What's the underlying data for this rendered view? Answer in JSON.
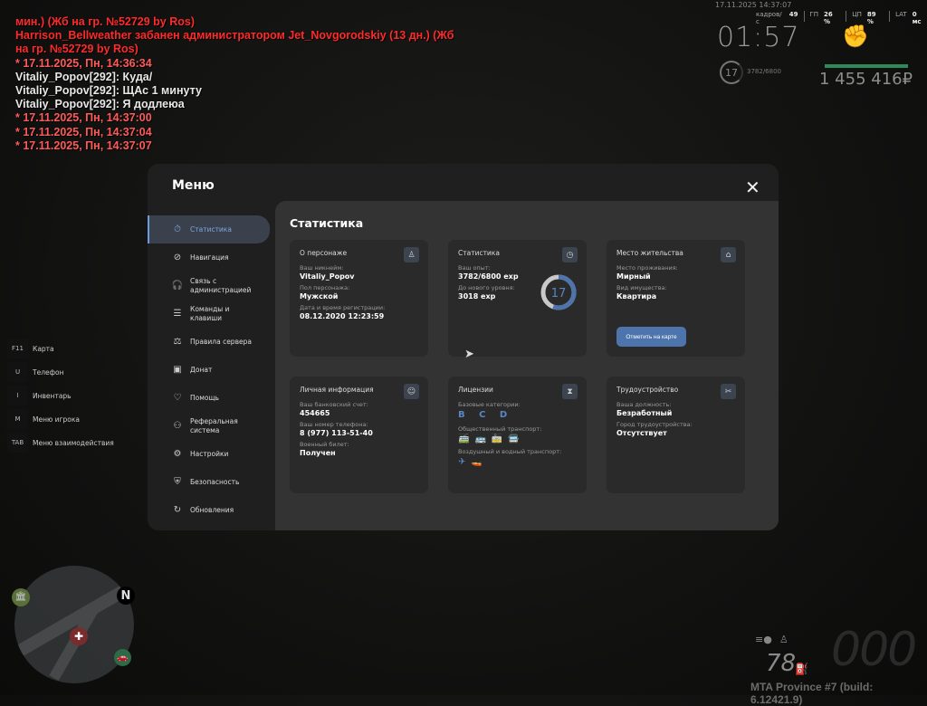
{
  "chat": [
    {
      "text": "мин.) (Жб на гр. №52729 by Ros)",
      "color": "red"
    },
    {
      "text": "Harrison_Bellweather забанен администратором Jet_Novgorodskiy (13 дн.) (Жб",
      "color": "red"
    },
    {
      "text": "на гр. №52729 by Ros)",
      "color": "red"
    },
    {
      "text": "* 17.11.2025, Пн, 14:36:34",
      "color": "pink"
    },
    {
      "text": "Vitaliy_Popov[292]: Куда/",
      "color": "white"
    },
    {
      "text": "Vitaliy_Popov[292]: ЩАс  1 минуту",
      "color": "white"
    },
    {
      "text": "Vitaliy_Popov[292]: Я додлеюа",
      "color": "white"
    },
    {
      "text": "* 17.11.2025, Пн, 14:37:00",
      "color": "pink"
    },
    {
      "text": "* 17.11.2025, Пн, 14:37:04",
      "color": "pink"
    },
    {
      "text": "* 17.11.2025, Пн, 14:37:07",
      "color": "pink"
    }
  ],
  "hud": {
    "datetime": "17.11.2025 14:37:07",
    "fps_label": "кадров/с",
    "fps": "49",
    "gpu_label": "ГП",
    "gpu": "26 %",
    "cpu_label": "ЦП",
    "cpu": "89 %",
    "lat_label": "LAT",
    "lat": "0 мс",
    "clock": "01:57",
    "level": "17",
    "exp": "3782/6800",
    "money": "1 455 416₽",
    "health_pct": 100,
    "fuel": "78",
    "speed": "000",
    "build": "MTA Province #7 (build: 6.12421.9)",
    "minimap_north": "N"
  },
  "hints": [
    {
      "key": "F11",
      "label": "Карта"
    },
    {
      "key": "U",
      "label": "Телефон"
    },
    {
      "key": "I",
      "label": "Инвентарь"
    },
    {
      "key": "M",
      "label": "Меню игрока"
    },
    {
      "key": "TAB",
      "label": "Меню взаимодействия"
    }
  ],
  "menu": {
    "title": "Меню",
    "close": "✕",
    "items": [
      {
        "label": "Статистика",
        "icon": "⏱",
        "active": true
      },
      {
        "label": "Навигация",
        "icon": "⊘"
      },
      {
        "label": "Связь с администрацией",
        "icon": "🎧"
      },
      {
        "label": "Команды и клавиши",
        "icon": "☰"
      },
      {
        "label": "Правила сервера",
        "icon": "⚖"
      },
      {
        "label": "Донат",
        "icon": "▣"
      },
      {
        "label": "Помощь",
        "icon": "♡"
      },
      {
        "label": "Реферальная система",
        "icon": "⚇"
      },
      {
        "label": "Настройки",
        "icon": "⚙"
      },
      {
        "label": "Безопасность",
        "icon": "⛨"
      },
      {
        "label": "Обновления",
        "icon": "↻"
      }
    ]
  },
  "content": {
    "title": "Статистика",
    "character": {
      "title": "О персонаже",
      "nick_label": "Ваш никнейм:",
      "nick": "Vitaliy_Popov",
      "sex_label": "Пол персонажа:",
      "sex": "Мужской",
      "reg_label": "Дата и время регистрации:",
      "reg": "08.12.2020 12:23:59"
    },
    "stats": {
      "title": "Статистика",
      "exp_label": "Ваш опыт:",
      "exp": "3782/6800 exp",
      "next_label": "До нового уровня:",
      "next": "3018 exp",
      "level": "17",
      "progress": 0.556,
      "accent": "#4d74ac"
    },
    "residence": {
      "title": "Место жительства",
      "place_label": "Место проживания:",
      "place": "Мирный",
      "type_label": "Вид имущества:",
      "type": "Квартира",
      "button": "Отметить на карте"
    },
    "personal": {
      "title": "Личная информация",
      "bank_label": "Ваш банковский счет:",
      "bank": "454665",
      "phone_label": "Ваш номер телефона:",
      "phone": "8 (977) 113-51-40",
      "military_label": "Военный билет:",
      "military": "Получен"
    },
    "licenses": {
      "title": "Лицензии",
      "basic_label": "Базовые категории:",
      "basic": "B C D",
      "public_label": "Общественный транспорт:",
      "public_icons": "🚎🚌🚋🚍",
      "air_label": "Воздушный и водный транспорт:",
      "air_icons": "✈🚤"
    },
    "employment": {
      "title": "Трудоустройство",
      "position_label": "Ваша должность:",
      "position": "Безработный",
      "city_label": "Город трудоустройства:",
      "city": "Отсутствует"
    }
  }
}
